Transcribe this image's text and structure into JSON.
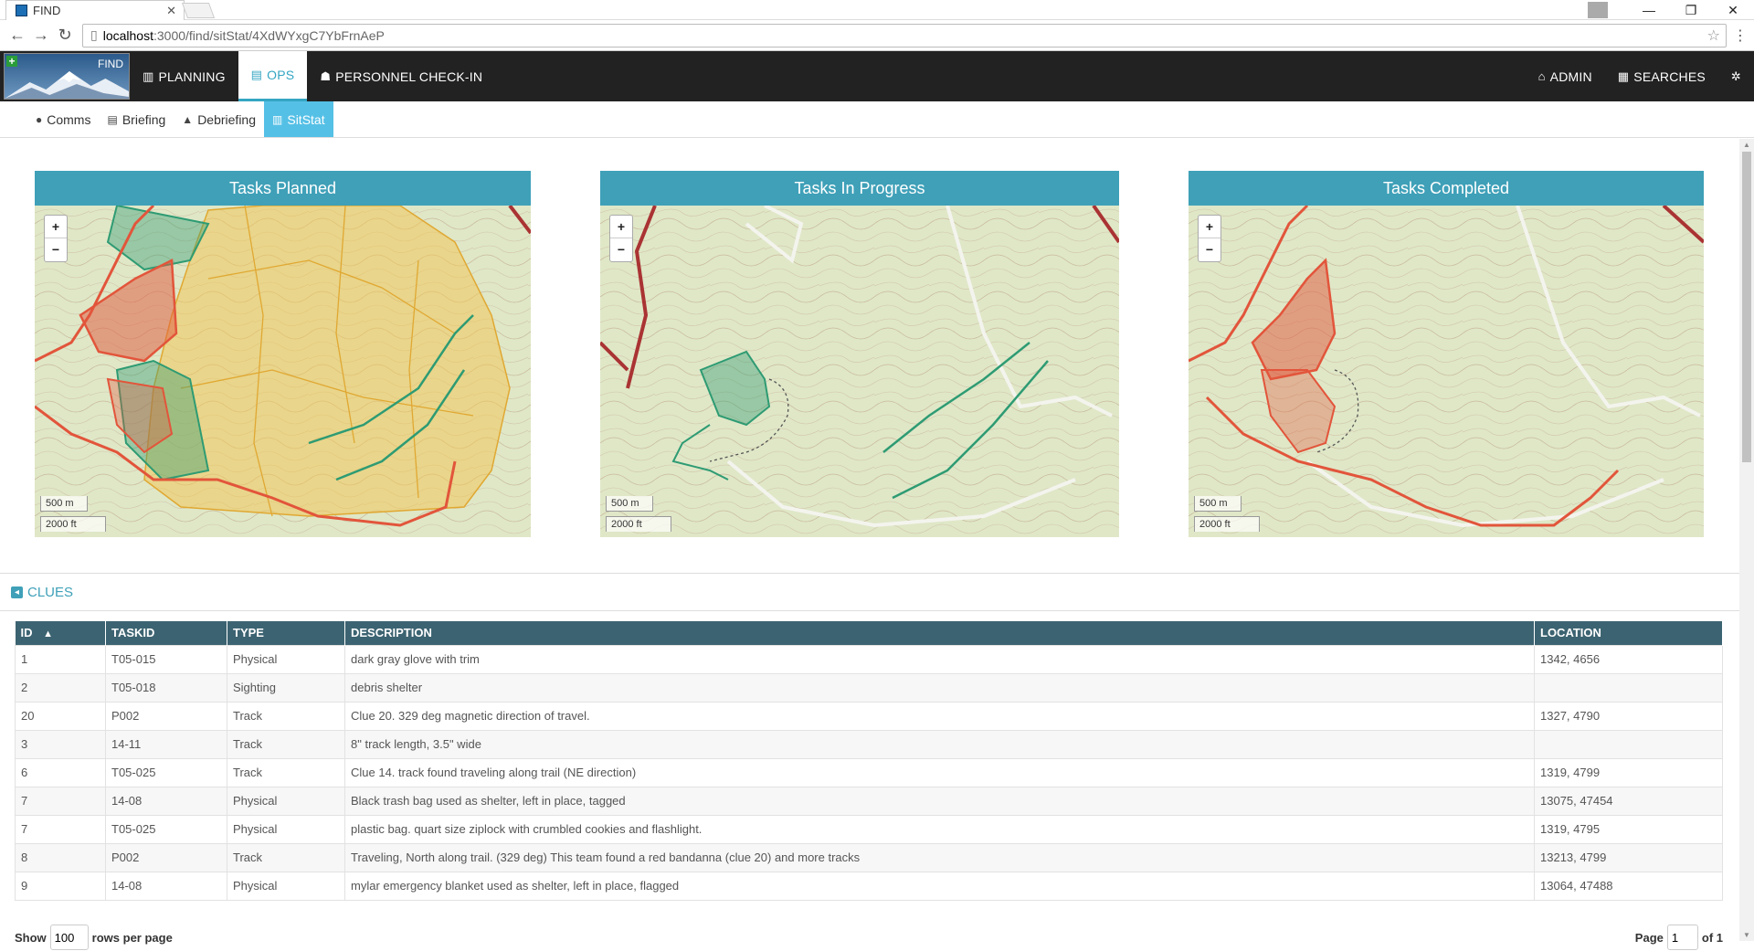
{
  "browser": {
    "tab_title": "FIND",
    "url_host": "localhost",
    "url_path": ":3000/find/sitStat/4XdWYxgC7YbFrnAeP"
  },
  "nav": {
    "logo_text": "FIND",
    "planning": "PLANNING",
    "ops": "OPS",
    "checkin": "PERSONNEL CHECK-IN",
    "admin": "ADMIN",
    "searches": "SEARCHES"
  },
  "subnav": {
    "comms": "Comms",
    "briefing": "Briefing",
    "debriefing": "Debriefing",
    "sitstat": "SitStat"
  },
  "panels": [
    {
      "title": "Tasks Planned",
      "scale_m": "500 m",
      "scale_ft": "2000 ft"
    },
    {
      "title": "Tasks In Progress",
      "scale_m": "500 m",
      "scale_ft": "2000 ft"
    },
    {
      "title": "Tasks Completed",
      "scale_m": "500 m",
      "scale_ft": "2000 ft"
    }
  ],
  "clues": {
    "title": "CLUES",
    "headers": {
      "id": "ID",
      "taskid": "TASKID",
      "type": "TYPE",
      "description": "DESCRIPTION",
      "location": "LOCATION"
    },
    "sort_indicator": "▲",
    "rows": [
      {
        "id": "1",
        "taskid": "T05-015",
        "type": "Physical",
        "description": "dark gray glove with trim",
        "location": "1342, 4656"
      },
      {
        "id": "2",
        "taskid": "T05-018",
        "type": "Sighting",
        "description": "debris shelter",
        "location": ""
      },
      {
        "id": "20",
        "taskid": "P002",
        "type": "Track",
        "description": "Clue 20. 329 deg magnetic direction of travel.",
        "location": "1327, 4790"
      },
      {
        "id": "3",
        "taskid": "14-11",
        "type": "Track",
        "description": "8\" track length, 3.5\" wide",
        "location": ""
      },
      {
        "id": "6",
        "taskid": "T05-025",
        "type": "Track",
        "description": "Clue 14. track found traveling along trail (NE direction)",
        "location": "1319, 4799"
      },
      {
        "id": "7",
        "taskid": "14-08",
        "type": "Physical",
        "description": "Black trash bag used as shelter, left in place, tagged",
        "location": "13075, 47454"
      },
      {
        "id": "7",
        "taskid": "T05-025",
        "type": "Physical",
        "description": "plastic bag. quart size ziplock with crumbled cookies and flashlight.",
        "location": "1319, 4795"
      },
      {
        "id": "8",
        "taskid": "P002",
        "type": "Track",
        "description": "Traveling, North along trail. (329 deg) This team found a red bandanna (clue 20) and more tracks",
        "location": "13213, 4799"
      },
      {
        "id": "9",
        "taskid": "14-08",
        "type": "Physical",
        "description": "mylar emergency blanket used as shelter, left in place, flagged",
        "location": "13064, 47488"
      }
    ]
  },
  "pager": {
    "show": "Show",
    "rows_value": "100",
    "rows_per_page": "rows per page",
    "page": "Page",
    "page_value": "1",
    "of": "of 1"
  },
  "colors": {
    "nav_bg": "#222222",
    "accent": "#3fa0b8",
    "active_sub": "#55c0e6",
    "table_header": "#3c6371",
    "planned_fill": "#f1c75a",
    "completed_red": "#e2553b",
    "progress_green": "#2e9b73"
  }
}
